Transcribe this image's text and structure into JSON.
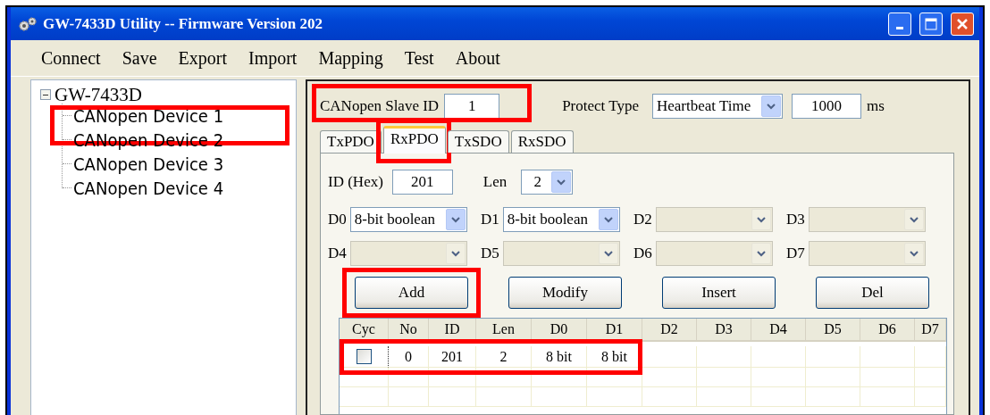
{
  "window": {
    "title": "GW-7433D Utility -- Firmware Version 202"
  },
  "menu": [
    "Connect",
    "Save",
    "Export",
    "Import",
    "Mapping",
    "Test",
    "About"
  ],
  "tree": {
    "label": "GW-7433D",
    "expanded": true,
    "children": [
      {
        "label": "CANopen Device 1",
        "highlighted": true
      },
      {
        "label": "CANopen Device 2"
      },
      {
        "label": "CANopen Device 3"
      },
      {
        "label": "CANopen Device 4"
      }
    ]
  },
  "slave": {
    "label": "CANopen Slave ID",
    "value": "1",
    "highlighted": true
  },
  "protect": {
    "label": "Protect Type",
    "value": "Heartbeat Time",
    "time": "1000",
    "unit": "ms"
  },
  "tabs": [
    {
      "label": "TxPDO",
      "selected": false
    },
    {
      "label": "RxPDO",
      "selected": true,
      "highlighted": true
    },
    {
      "label": "TxSDO",
      "selected": false
    },
    {
      "label": "RxSDO",
      "selected": false
    }
  ],
  "pdo": {
    "id_label": "ID (Hex)",
    "id_value": "201",
    "len_label": "Len",
    "len_value": "2",
    "slots": [
      {
        "label": "D0",
        "value": "8-bit boolean",
        "disabled": false
      },
      {
        "label": "D1",
        "value": "8-bit boolean",
        "disabled": false
      },
      {
        "label": "D2",
        "disabled": true
      },
      {
        "label": "D3",
        "disabled": true
      },
      {
        "label": "D4",
        "disabled": true
      },
      {
        "label": "D5",
        "disabled": true
      },
      {
        "label": "D6",
        "disabled": true
      },
      {
        "label": "D7",
        "disabled": true
      }
    ]
  },
  "buttons": [
    {
      "label": "Add",
      "highlighted": true
    },
    {
      "label": "Modify"
    },
    {
      "label": "Insert"
    },
    {
      "label": "Del"
    }
  ],
  "table": {
    "columns": [
      "Cyc",
      "No",
      "ID",
      "Len",
      "D0",
      "D1",
      "D2",
      "D3",
      "D4",
      "D5",
      "D6",
      "D7"
    ],
    "rows": [
      {
        "checked": false,
        "cells": [
          "",
          "0",
          "201",
          "2",
          "8 bit",
          "8 bit"
        ],
        "highlighted": true
      }
    ]
  }
}
